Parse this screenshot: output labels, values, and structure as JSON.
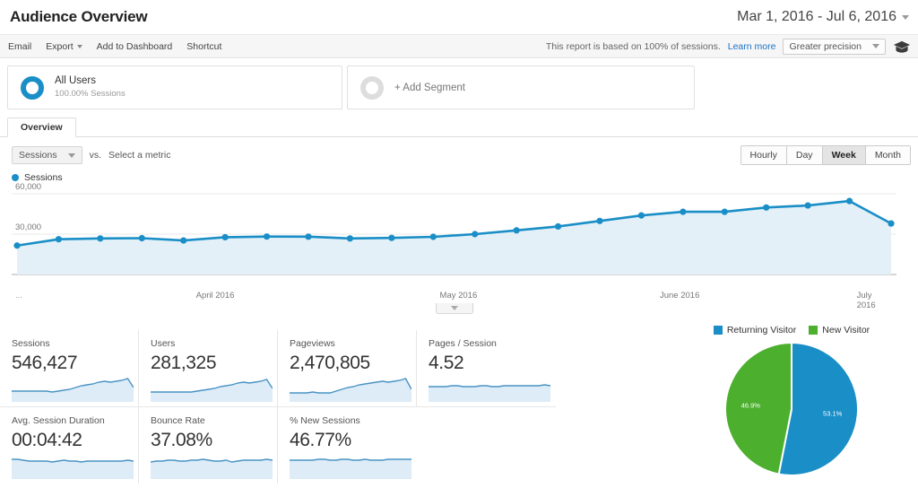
{
  "header": {
    "title": "Audience Overview",
    "date_range": "Mar 1, 2016 - Jul 6, 2016",
    "date_caret_icon": "chevron-down-icon"
  },
  "toolbar": {
    "items": [
      {
        "label": "Email",
        "has_caret": false
      },
      {
        "label": "Export",
        "has_caret": true
      },
      {
        "label": "Add to Dashboard",
        "has_caret": false
      },
      {
        "label": "Shortcut",
        "has_caret": false
      }
    ],
    "sampling_note": "This report is based on 100% of sessions.",
    "learn_more": "Learn more",
    "precision": "Greater precision",
    "precision_caret_icon": "chevron-down-icon",
    "help_icon": "graduation-cap-icon"
  },
  "segments": {
    "active": {
      "name": "All Users",
      "sub": "100.00% Sessions",
      "icon": "donut-icon",
      "color": "#1a8ec6"
    },
    "add": {
      "label": "+ Add Segment",
      "icon": "donut-empty-icon"
    }
  },
  "tabs": [
    {
      "label": "Overview",
      "active": true
    }
  ],
  "chart_controls": {
    "metric": "Sessions",
    "metric_caret_icon": "chevron-down-icon",
    "vs_label": "vs.",
    "select_metric": "Select a metric",
    "granularity": [
      {
        "label": "Hourly",
        "active": false
      },
      {
        "label": "Day",
        "active": false
      },
      {
        "label": "Week",
        "active": true
      },
      {
        "label": "Month",
        "active": false
      }
    ]
  },
  "chart_legend": {
    "label": "Sessions",
    "color": "#1a8ec6"
  },
  "slider": {
    "handle_icon": "chevron-down-icon"
  },
  "chart_data": {
    "type": "line",
    "title": "Sessions",
    "xlabel": "",
    "ylabel": "Sessions",
    "ylim": [
      0,
      60000
    ],
    "yticks": [
      30000,
      60000
    ],
    "ytick_labels": [
      "30,000",
      "60,000"
    ],
    "grid": true,
    "legend_position": "top-left",
    "x_tick_labels": [
      "...",
      "April 2016",
      "May 2016",
      "June 2016",
      "July 2016"
    ],
    "x_tick_positions": [
      0.4,
      23.0,
      50.5,
      75.5,
      97.0
    ],
    "series": [
      {
        "name": "Sessions",
        "color": "#1a8ec6",
        "fill": "#e3f0f8",
        "values": [
          21500,
          26200,
          26800,
          27000,
          25300,
          27700,
          28200,
          28100,
          26800,
          27200,
          28000,
          30000,
          32800,
          35700,
          39800,
          43900,
          46600,
          46600,
          49800,
          51300,
          54600,
          37900
        ]
      }
    ]
  },
  "metric_cards": [
    {
      "label": "Sessions",
      "value": "546,427",
      "spark": [
        12,
        12,
        12,
        12,
        12,
        12,
        12,
        11,
        12,
        13,
        14,
        16,
        18,
        19,
        20,
        22,
        23,
        22,
        23,
        24,
        26,
        16
      ]
    },
    {
      "label": "Users",
      "value": "281,325",
      "spark": [
        11,
        11,
        11,
        11,
        11,
        11,
        11,
        11,
        12,
        13,
        14,
        15,
        17,
        18,
        19,
        21,
        22,
        21,
        22,
        23,
        25,
        15
      ]
    },
    {
      "label": "Pageviews",
      "value": "2,470,805",
      "spark": [
        10,
        10,
        10,
        10,
        11,
        10,
        10,
        10,
        12,
        14,
        16,
        17,
        19,
        20,
        21,
        22,
        23,
        22,
        23,
        24,
        26,
        14
      ]
    },
    {
      "label": "Pages / Session",
      "value": "4.52",
      "spark": [
        17,
        17,
        17,
        17,
        18,
        18,
        17,
        17,
        17,
        18,
        18,
        17,
        17,
        18,
        18,
        18,
        18,
        18,
        18,
        18,
        19,
        18
      ]
    },
    {
      "label": "Avg. Session Duration",
      "value": "00:04:42",
      "spark": [
        22,
        22,
        21,
        20,
        20,
        20,
        20,
        19,
        20,
        21,
        20,
        20,
        19,
        20,
        20,
        20,
        20,
        20,
        20,
        20,
        21,
        20
      ]
    },
    {
      "label": "Bounce Rate",
      "value": "37.08%",
      "spark": [
        19,
        20,
        20,
        21,
        21,
        20,
        20,
        21,
        21,
        22,
        21,
        20,
        20,
        21,
        19,
        20,
        21,
        21,
        21,
        21,
        22,
        21
      ]
    },
    {
      "label": "% New Sessions",
      "value": "46.77%",
      "spark": [
        21,
        21,
        21,
        21,
        21,
        22,
        22,
        21,
        21,
        22,
        22,
        21,
        21,
        22,
        21,
        21,
        21,
        22,
        22,
        22,
        22,
        22
      ]
    }
  ],
  "pie_chart": {
    "type": "pie",
    "title": "",
    "legend_position": "top",
    "labels": [
      "Returning Visitor",
      "New Visitor"
    ],
    "values": [
      53.1,
      46.9
    ],
    "value_labels": [
      "53.1%",
      "46.9%"
    ],
    "colors": [
      "#1a8ec6",
      "#4caf2e"
    ]
  }
}
